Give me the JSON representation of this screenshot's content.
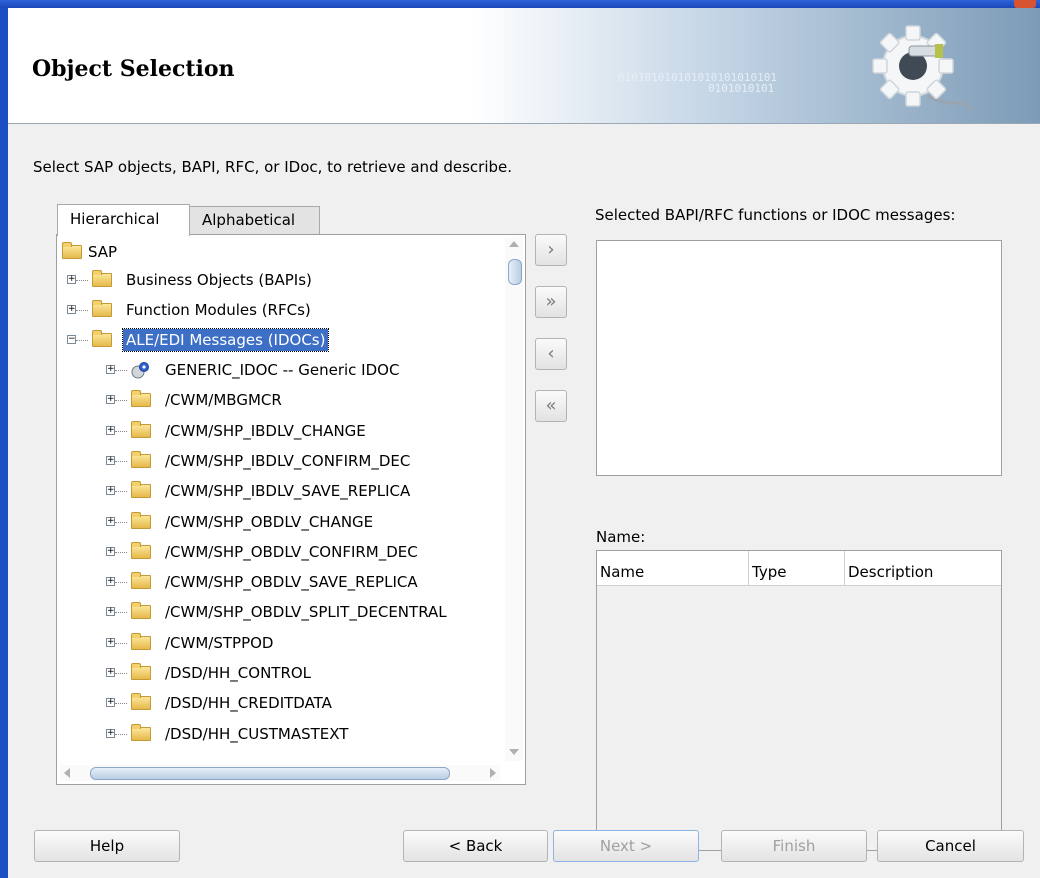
{
  "header": {
    "title": "Object Selection",
    "binary_line1": "010101010101010101010101",
    "binary_line2": "0101010101"
  },
  "instructions": "Select SAP objects, BAPI, RFC, or IDoc, to retrieve and describe.",
  "tabs": [
    {
      "label": "Hierarchical",
      "active": true
    },
    {
      "label": "Alphabetical",
      "active": false
    }
  ],
  "tree": {
    "root": "SAP",
    "categories": [
      "Business Objects (BAPIs)",
      "Function Modules (RFCs)",
      "ALE/EDI Messages (IDOCs)"
    ],
    "idoc_items": [
      "GENERIC_IDOC -- Generic IDOC",
      "/CWM/MBGMCR",
      "/CWM/SHP_IBDLV_CHANGE",
      "/CWM/SHP_IBDLV_CONFIRM_DEC",
      "/CWM/SHP_IBDLV_SAVE_REPLICA",
      "/CWM/SHP_OBDLV_CHANGE",
      "/CWM/SHP_OBDLV_CONFIRM_DEC",
      "/CWM/SHP_OBDLV_SAVE_REPLICA",
      "/CWM/SHP_OBDLV_SPLIT_DECENTRAL",
      "/CWM/STPPOD",
      "/DSD/HH_CONTROL",
      "/DSD/HH_CREDITDATA",
      "/DSD/HH_CUSTMASTEXT"
    ]
  },
  "move_buttons": {
    "add": "›",
    "add_all": "»",
    "remove": "‹",
    "remove_all": "«"
  },
  "selected": {
    "label": "Selected BAPI/RFC functions or IDOC messages:"
  },
  "name_section": {
    "label": "Name:",
    "columns": [
      "Name",
      "Type",
      "Description"
    ]
  },
  "footer": {
    "help": "Help",
    "back": "< Back",
    "next": "Next >",
    "finish": "Finish",
    "cancel": "Cancel"
  }
}
